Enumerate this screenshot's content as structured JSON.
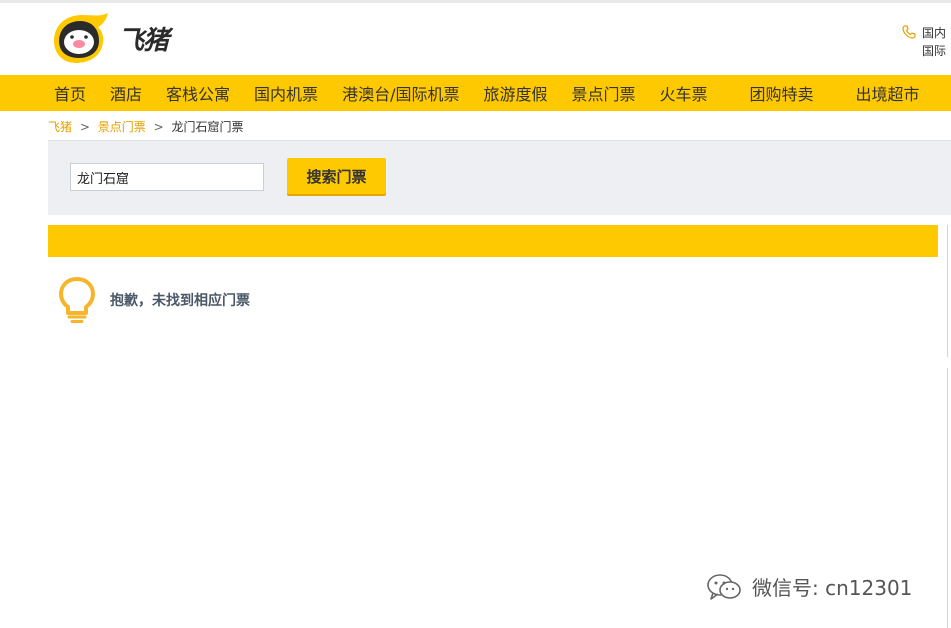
{
  "brand": {
    "name": "飞猪",
    "accent_color": "#ffc900",
    "logo_icon": "fliggy-pig-icon"
  },
  "hotline": {
    "icon": "phone-icon",
    "line1": "国内",
    "line2": "国际"
  },
  "nav": {
    "items": [
      "首页",
      "酒店",
      "客栈公寓",
      "国内机票",
      "港澳台/国际机票",
      "旅游度假",
      "景点门票",
      "火车票",
      "团购特卖",
      "出境超市"
    ]
  },
  "breadcrumb": {
    "home": "飞猪",
    "sep1": ">",
    "category": "景点门票",
    "sep2": ">",
    "current": "龙门石窟门票"
  },
  "search": {
    "value": "龙门石窟",
    "button_label": "搜索门票"
  },
  "notice": {
    "icon": "lightbulb-icon",
    "text": "抱歉，未找到相应门票"
  },
  "watermark": {
    "icon": "wechat-icon",
    "text": "微信号: cn12301"
  }
}
